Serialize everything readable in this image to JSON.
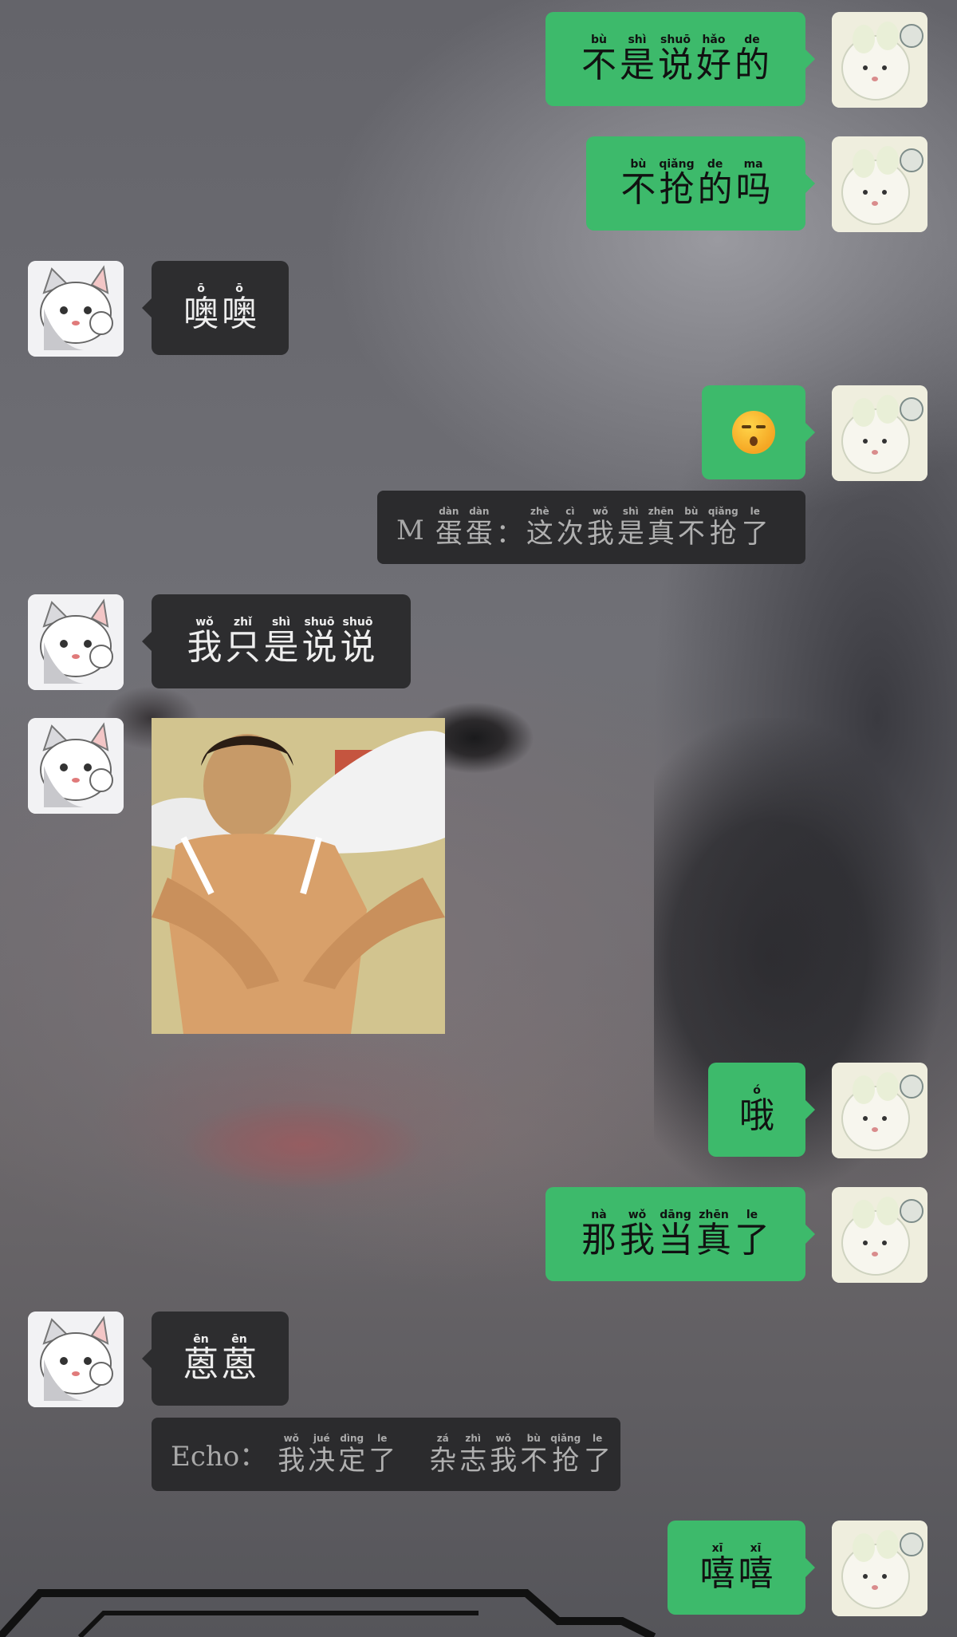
{
  "messages": [
    {
      "id": "m1",
      "side": "me",
      "type": "text",
      "chars": [
        "不",
        "是",
        "说",
        "好",
        "的"
      ],
      "pinyin": [
        "bù",
        "shì",
        "shuō",
        "hǎo",
        "de"
      ]
    },
    {
      "id": "m2",
      "side": "me",
      "type": "text",
      "chars": [
        "不",
        "抢",
        "的",
        "吗"
      ],
      "pinyin": [
        "bù",
        "qiǎng",
        "de",
        "ma"
      ]
    },
    {
      "id": "m3",
      "side": "other",
      "type": "text",
      "chars": [
        "噢",
        "噢"
      ],
      "pinyin": [
        "ō",
        "ō"
      ]
    },
    {
      "id": "m4",
      "side": "me",
      "type": "emoji",
      "icon": "kissing-face-emoji"
    },
    {
      "id": "m5",
      "type": "notice",
      "prefix": "M",
      "chars": [
        "蛋",
        "蛋",
        "：",
        "这",
        "次",
        "我",
        "是",
        "真",
        "不",
        "抢",
        "了"
      ],
      "pinyin": [
        "dàn",
        "dàn",
        "",
        "zhè",
        "cì",
        "wǒ",
        "shì",
        "zhēn",
        "bù",
        "qiǎng",
        "le"
      ]
    },
    {
      "id": "m6",
      "side": "other",
      "type": "text",
      "chars": [
        "我",
        "只",
        "是",
        "说",
        "说"
      ],
      "pinyin": [
        "wǒ",
        "zhǐ",
        "shì",
        "shuō",
        "shuō"
      ]
    },
    {
      "id": "m7",
      "side": "other",
      "type": "image",
      "description": "man with angel wings meme"
    },
    {
      "id": "m8",
      "side": "me",
      "type": "text",
      "chars": [
        "哦"
      ],
      "pinyin": [
        "ó"
      ]
    },
    {
      "id": "m9",
      "side": "me",
      "type": "text",
      "chars": [
        "那",
        "我",
        "当",
        "真",
        "了"
      ],
      "pinyin": [
        "nà",
        "wǒ",
        "dāng",
        "zhēn",
        "le"
      ]
    },
    {
      "id": "m10",
      "side": "other",
      "type": "text",
      "chars": [
        "蒽",
        "蒽"
      ],
      "pinyin": [
        "ēn",
        "ēn"
      ]
    },
    {
      "id": "m11",
      "type": "notice",
      "prefix": "Echo：",
      "chars": [
        "我",
        "决",
        "定",
        "了",
        "",
        "杂",
        "志",
        "我",
        "不",
        "抢",
        "了"
      ],
      "pinyin": [
        "wǒ",
        "jué",
        "dìng",
        "le",
        "",
        "zá",
        "zhì",
        "wǒ",
        "bù",
        "qiǎng",
        "le"
      ]
    },
    {
      "id": "m12",
      "side": "me",
      "type": "text",
      "chars": [
        "嘻",
        "嘻"
      ],
      "pinyin": [
        "xī",
        "xī"
      ]
    }
  ],
  "colors": {
    "my_bubble": "#3dba6b",
    "other_bubble": "#2d2d2f",
    "notice_bg": "#2b2b2d"
  }
}
